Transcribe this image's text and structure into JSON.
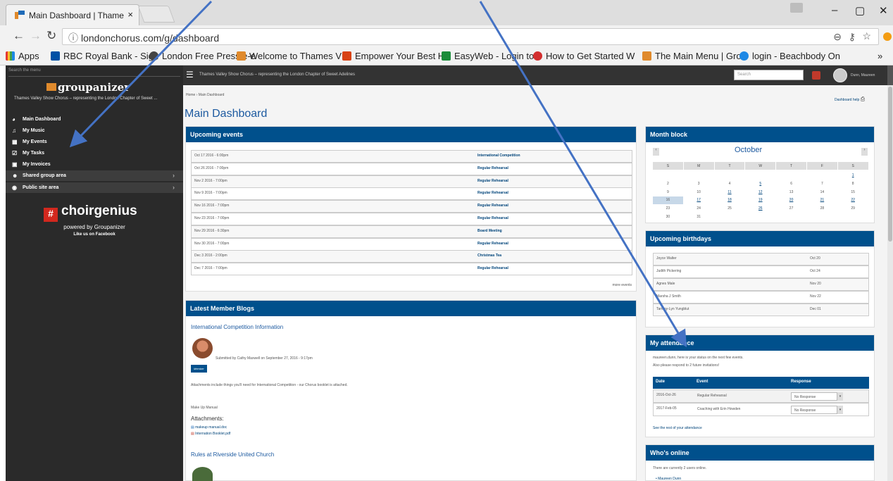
{
  "browser": {
    "tab_title": "Main Dashboard | Thame",
    "tab_close": "×",
    "url": "londonchorus.com/g/dashboard",
    "window_controls": {
      "minimize": "–",
      "maximize": "▢",
      "close": "✕"
    },
    "bookmarks": [
      {
        "label": "Apps",
        "color": "#e53935"
      },
      {
        "label": "RBC Royal Bank - Sign",
        "color": "#0051a5"
      },
      {
        "label": "London Free Press e-e",
        "color": "#444"
      },
      {
        "label": "Welcome to Thames V",
        "color": "#e08a2c"
      },
      {
        "label": "Empower Your Best H",
        "color": "#d84315"
      },
      {
        "label": "EasyWeb - Login to o",
        "color": "#1b8c3a"
      },
      {
        "label": "How to Get Started W",
        "color": "#d32f2f"
      },
      {
        "label": "The Main Menu | Grou",
        "color": "#e08a2c"
      },
      {
        "label": "login - Beachbody On",
        "color": "#1e88e5"
      }
    ],
    "bookmarks_overflow": "»"
  },
  "sidebar": {
    "search_placeholder": "Search the menu",
    "logo_text": "groupanizer",
    "group_name": "Thames Valley Show Chorus – representing the London Chapter of Sweet ...",
    "items": [
      {
        "label": "Main Dashboard",
        "icon": "dashboard-icon"
      },
      {
        "label": "My Music",
        "icon": "music-icon"
      },
      {
        "label": "My Events",
        "icon": "calendar-icon"
      },
      {
        "label": "My Tasks",
        "icon": "checkbox-icon"
      },
      {
        "label": "My Invoices",
        "icon": "invoice-icon"
      },
      {
        "label": "Shared group area",
        "icon": "group-icon"
      },
      {
        "label": "Public site area",
        "icon": "globe-icon"
      }
    ],
    "brand": "choirgenius",
    "powered_by": "powered by Groupanizer",
    "like_us": "Like us on Facebook"
  },
  "topbar": {
    "title": "Thames Valley Show Chorus – representing the London Chapter of Sweet Adelines",
    "search_placeholder": "Search",
    "user": "Dunn, Maureen"
  },
  "page": {
    "breadcrumb": "Home › Main Dashboard",
    "help": "Dashboard help",
    "title": "Main Dashboard"
  },
  "upcoming_events": {
    "heading": "Upcoming events",
    "rows": [
      {
        "date": "Oct 17 2016 - 6:00pm",
        "event": "International Competition"
      },
      {
        "date": "Oct 26 2016 - 7:00pm",
        "event": "Regular Rehearsal"
      },
      {
        "date": "Nov 2 2016 - 7:00pm",
        "event": "Regular Rehearsal"
      },
      {
        "date": "Nov 9 2016 - 7:00pm",
        "event": "Regular Rehearsal"
      },
      {
        "date": "Nov 16 2016 - 7:00pm",
        "event": "Regular Rehearsal"
      },
      {
        "date": "Nov 23 2016 - 7:00pm",
        "event": "Regular Rehearsal"
      },
      {
        "date": "Nov 29 2016 - 6:30pm",
        "event": "Board Meeting"
      },
      {
        "date": "Nov 30 2016 - 7:00pm",
        "event": "Regular Rehearsal"
      },
      {
        "date": "Dec 3 2016 - 2:00pm",
        "event": "Christmas Tea"
      },
      {
        "date": "Dec 7 2016 - 7:00pm",
        "event": "Regular Rehearsal"
      }
    ],
    "more": "more events"
  },
  "blogs": {
    "heading": "Latest Member Blogs",
    "post1_title": "International Competition Information",
    "post1_submitted": "Submitted by Cathy Maxwell on September 27, 2016 - 9:17pm",
    "post1_badge": "Member",
    "post1_body": "Attachments include things you'll need for International Competition - our Chorus booklet is attached.",
    "post1_extra": "Make Up Manual",
    "attachments_heading": "Attachments:",
    "attachments": [
      "makeup manual.doc",
      "Internation Booklet.pdf"
    ],
    "post2_title": "Rules at Riverside United Church"
  },
  "month_block": {
    "heading": "Month block",
    "month": "October",
    "prev": "‹",
    "next": "›",
    "days": [
      "S",
      "M",
      "T",
      "W",
      "T",
      "F",
      "S"
    ],
    "weeks": [
      [
        "",
        "",
        "",
        "",
        "",
        "",
        "1"
      ],
      [
        "2",
        "3",
        "4",
        "5",
        "6",
        "7",
        "8"
      ],
      [
        "9",
        "10",
        "11",
        "12",
        "13",
        "14",
        "15"
      ],
      [
        "16",
        "17",
        "18",
        "19",
        "20",
        "21",
        "22"
      ],
      [
        "23",
        "24",
        "25",
        "26",
        "27",
        "28",
        "29"
      ],
      [
        "30",
        "31",
        "",
        "",
        "",
        "",
        ""
      ]
    ],
    "linked_days": [
      "1",
      "5",
      "11",
      "12",
      "17",
      "18",
      "19",
      "20",
      "21",
      "22",
      "26"
    ],
    "today": "16"
  },
  "birthdays": {
    "heading": "Upcoming birthdays",
    "rows": [
      {
        "name": "Joyce Walter",
        "date": "Oct 20"
      },
      {
        "name": "Judith Pickering",
        "date": "Oct 24"
      },
      {
        "name": "Agnes Male",
        "date": "Nov 20"
      },
      {
        "name": "Marsha J Smith",
        "date": "Nov 22"
      },
      {
        "name": "Tammy-Lyn Yungblut",
        "date": "Dec 01"
      }
    ]
  },
  "attendance": {
    "heading": "My attendance",
    "intro1": "maureen.dunn, here is your status on the next few events.",
    "intro2": "Also please respond to 2 future invitations!",
    "cols": [
      "Date",
      "Event",
      "Response"
    ],
    "rows": [
      {
        "date": "2016-Oct-26",
        "event": "Regular Rehearsal",
        "response": "No Response"
      },
      {
        "date": "2017-Feb-05",
        "event": "Coaching with Erin Howden",
        "response": "No Response"
      }
    ],
    "see_rest": "See the rest of your attendance"
  },
  "whos_online": {
    "heading": "Who's online",
    "text": "There are currently 2 users online.",
    "users": [
      "Maureen Dunn"
    ]
  }
}
